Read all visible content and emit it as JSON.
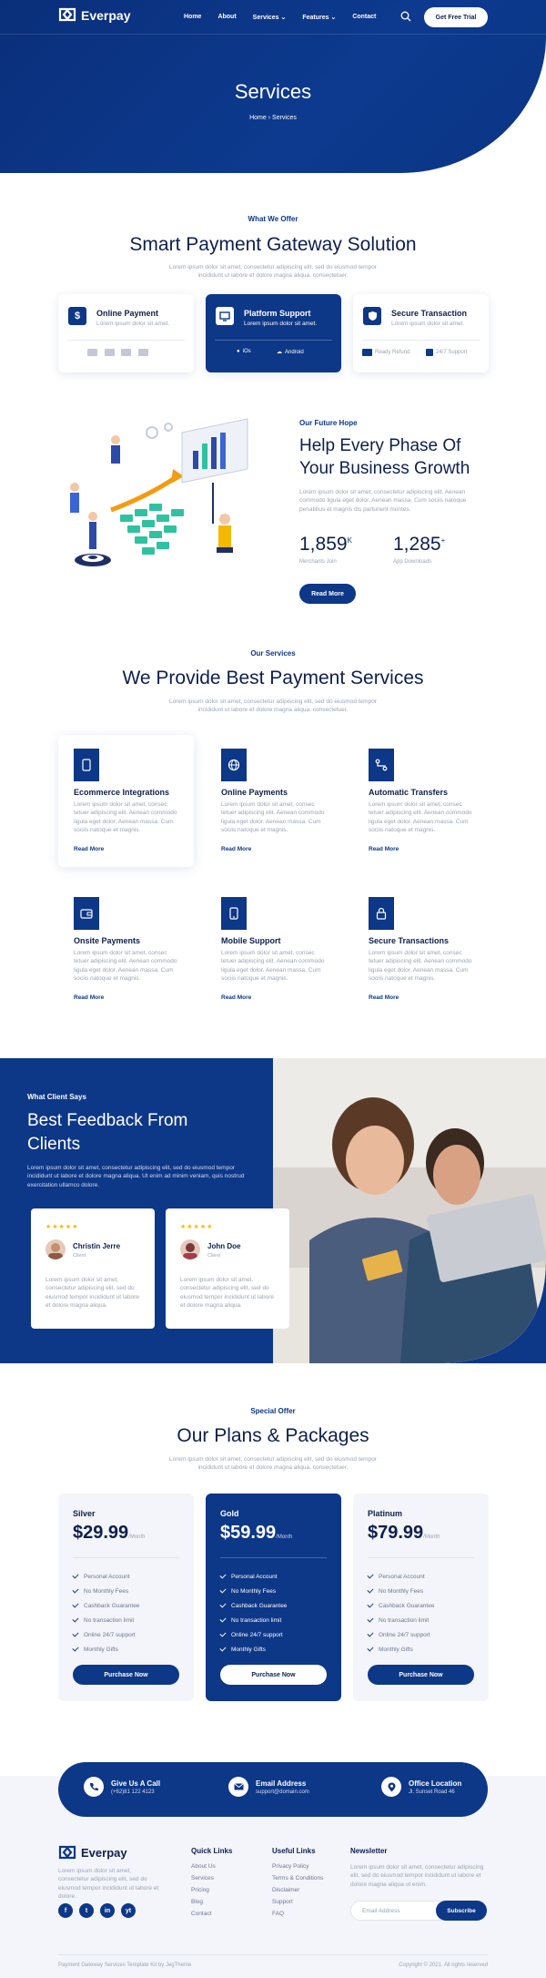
{
  "brand": {
    "name": "Everpay",
    "primary": "#0d3787",
    "dark_text": "#0e1f4d",
    "star": "#f5b800"
  },
  "nav": {
    "items": [
      "Home",
      "About",
      "Services",
      "Features",
      "Contact"
    ],
    "cta": "Get Free Trial",
    "search_icon": "search-icon"
  },
  "hero": {
    "title": "Services",
    "crumb_home": "Home",
    "crumb_current": "Services"
  },
  "offer": {
    "kicker": "What We Offer",
    "title": "Smart Payment Gateway Solution",
    "text": "Lorem ipsum dolor sit amet, consectetur adipiscing elit, sed do eiusmod tempor incididunt ut labore et dolore magna aliqua. consectetuer.",
    "cards": [
      {
        "title": "Online Payment",
        "sub": "Lorem ipsum dolor sit amet.",
        "icon": "dollar-icon"
      },
      {
        "title": "Platform Support",
        "sub": "Lorem ipsum dolor sit amet.",
        "icon": "monitor-icon",
        "f1": "iOs",
        "f2": "Android"
      },
      {
        "title": "Secure Transaction",
        "sub": "Lorem ipsum dolor sit amet.",
        "icon": "shield-icon",
        "f1": "Ready Refund",
        "f2": "24/7 Support"
      }
    ]
  },
  "growth": {
    "kicker": "Our Future Hope",
    "title_line1": "Help Every Phase Of",
    "title_line2": "Your Business Growth",
    "text": "Lorem ipsum dolor sit amet, consectetur adipiscing elit. Aenean commodo ligula eget dolor. Aenean massa. Cum sociis natoque penatibus et magnis dis parturient montes.",
    "stat1_value": "1,859",
    "stat1_sup": "K",
    "stat1_label": "Merchants Join",
    "stat2_value": "1,285",
    "stat2_sup": "+",
    "stat2_label": "App Downloads",
    "button": "Read More"
  },
  "services": {
    "kicker": "Our Services",
    "title": "We Provide Best Payment Services",
    "text": "Lorem ipsum dolor sit amet, consectetur adipiscing elit, sed do eiusmod tempor incididunt ut labore et dolore magna aliqua. consectetuer.",
    "desc": "Lorem ipsum dolor sit amet, consec tetuer adipiscing elit. Aenean commodo ligula eget dolor. Aenean massa. Cum sociis natoque et magnis.",
    "read_more": "Read More",
    "items": [
      {
        "title": "Ecommerce Integrations",
        "icon": "mobile-icon"
      },
      {
        "title": "Online Payments",
        "icon": "globe-icon"
      },
      {
        "title": "Automatic Transfers",
        "icon": "transfer-icon"
      },
      {
        "title": "Onsite Payments",
        "icon": "wallet-icon"
      },
      {
        "title": "Mobile Support",
        "icon": "smartphone-icon"
      },
      {
        "title": "Secure Transactions",
        "icon": "lock-icon"
      }
    ]
  },
  "feedback": {
    "kicker": "What Client Says",
    "title_line1": "Best Feedback From",
    "title_line2": "Clients",
    "text": "Lorem ipsum dolor sit amet, consectetur adipiscing elit, sed do eiusmod tempor incididunt ut labore et dolore magna aliqua. Ut enim ad minim veniam, quis nostrud exercitation ullamco dolore.",
    "reviews": [
      {
        "name": "Christin Jerre",
        "role": "Client",
        "stars": "★★★★★",
        "quote": "Lorem ipsum dolor sit amet, consectetur adipiscing elit, sed do eiusmod tempor incididunt ut labore et dolore magna aliqua."
      },
      {
        "name": "John Doe",
        "role": "Client",
        "stars": "★★★★★",
        "quote": "Lorem ipsum dolor sit amet, consectetur adipiscing elit, sed do eiusmod tempor incididunt ut labore et dolore magna aliqua."
      }
    ]
  },
  "pricing": {
    "kicker": "Special Offer",
    "title": "Our Plans & Packages",
    "text": "Lorem ipsum dolor sit amet, consectetur adipiscing elit, sed do eiusmod tempor incididunt ut labore et dolore magna aliqua. consectetuer.",
    "per": "/Month",
    "button": "Purchase Now",
    "features": [
      "Personal Account",
      "No Monthly Fees",
      "Cashback Guarantee",
      "No transaction limit",
      "Online 24/7 support",
      "Monthly Gifts"
    ],
    "plans": [
      {
        "name": "Silver",
        "price": "$29.99"
      },
      {
        "name": "Gold",
        "price": "$59.99"
      },
      {
        "name": "Platinum",
        "price": "$79.99"
      }
    ]
  },
  "contact": [
    {
      "title": "Give Us A Call",
      "sub": "(+62)81 122 4123",
      "icon": "phone-icon"
    },
    {
      "title": "Email Address",
      "sub": "support@domain.com",
      "icon": "mail-icon"
    },
    {
      "title": "Office Location",
      "sub": "Jl. Sunset Road 46",
      "icon": "location-icon"
    }
  ],
  "footer": {
    "about": "Lorem ipsum dolor sit amet, consectetur adipiscing elit, sed do eiusmod tempor incididunt ut labore et dolore.",
    "socials": [
      "f",
      "t",
      "in",
      "yt"
    ],
    "quick_title": "Quick Links",
    "quick": [
      "About Us",
      "Services",
      "Pricing",
      "Blog",
      "Contact"
    ],
    "useful_title": "Useful Links",
    "useful": [
      "Privacy Policy",
      "Terms & Conditions",
      "Disclaimer",
      "Support",
      "FAQ"
    ],
    "news_title": "Newsletter",
    "news_text": "Lorem ipsum dolor sit amet, consectetur adipiscing elit, sed do eiusmod tempor incididunt ut labore et dolore magna aliqua ut enim.",
    "email_placeholder": "Email Address",
    "subscribe": "Subscribe",
    "copy_left": "Payment Gateway Services Template Kit by JegTheme",
    "copy_right": "Copyright © 2021. All rights reserved"
  }
}
